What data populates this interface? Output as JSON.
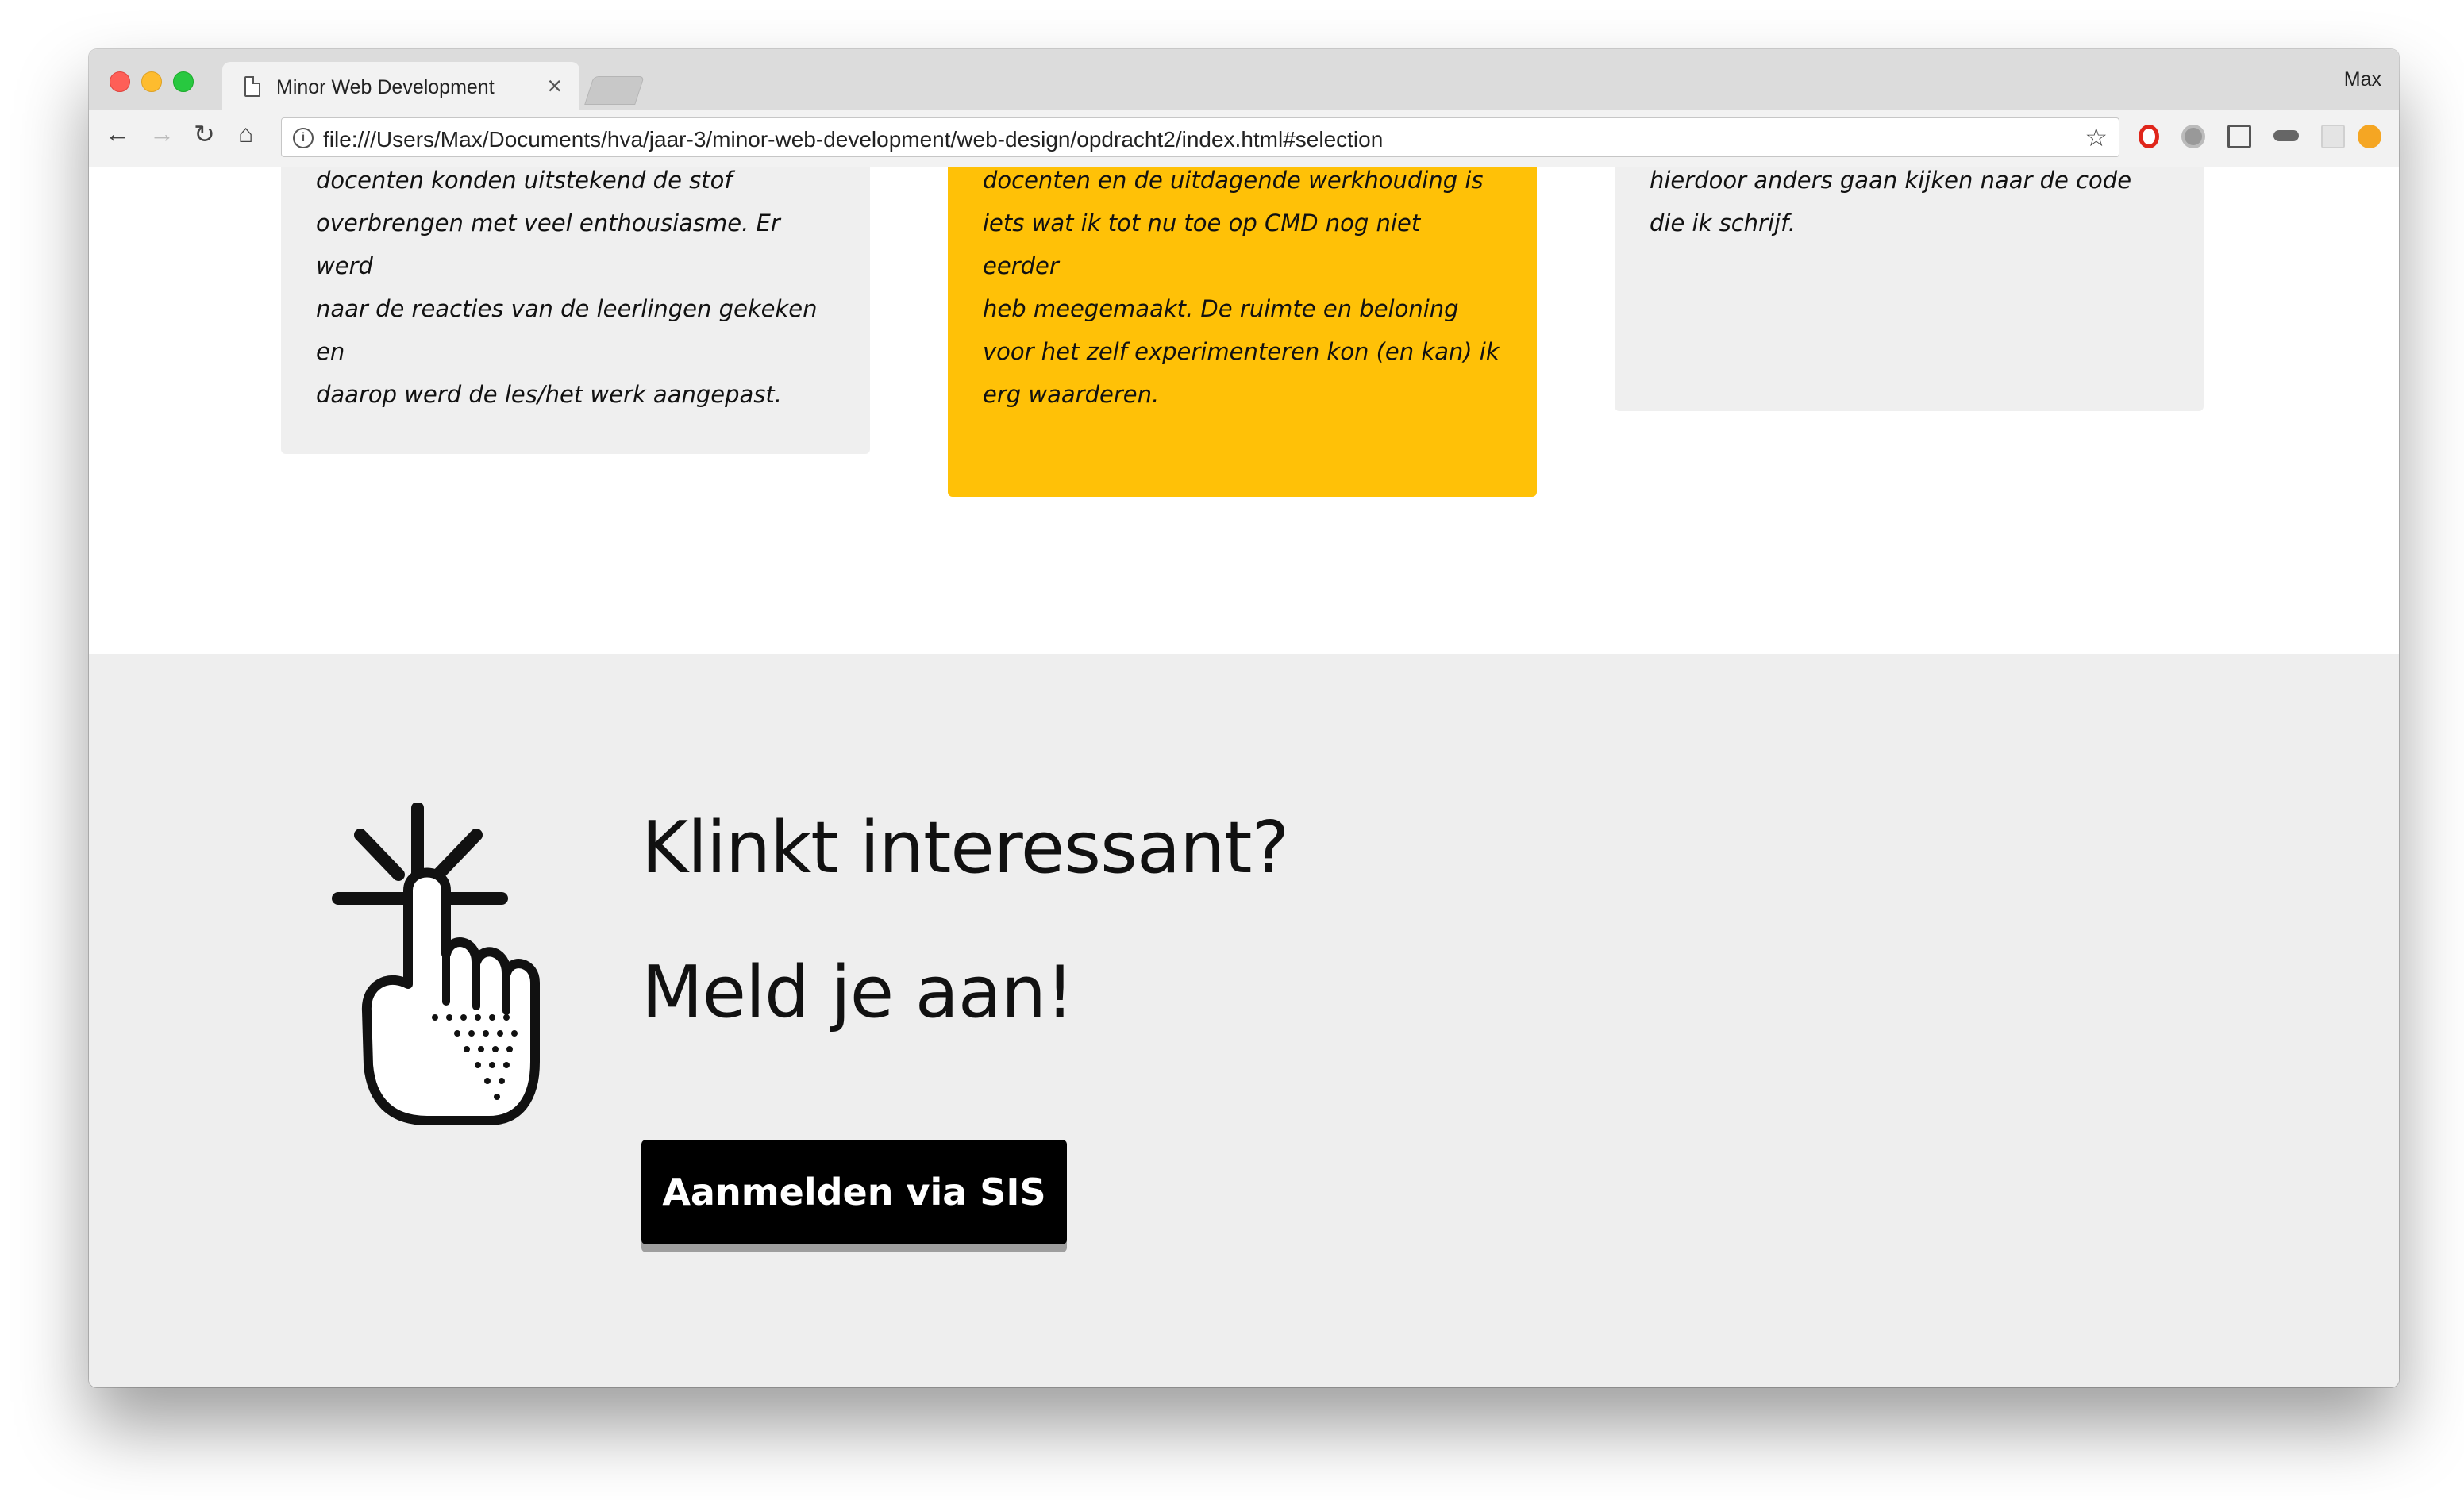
{
  "browser": {
    "tab_title": "Minor Web Development",
    "tab_close": "×",
    "profile_name": "Max",
    "url": "file:///Users/Max/Documents/hva/jaar-3/minor-web-development/web-design/opdracht2/index.html#selection",
    "nav": {
      "back": "←",
      "forward": "→",
      "reload": "↻",
      "home": "⌂",
      "bookmark": "☆"
    },
    "extensions": [
      "opera-icon",
      "settings-extension-icon",
      "cast-icon",
      "glasses-extension-icon",
      "grid-extension-icon",
      "upload-extension-icon"
    ]
  },
  "cards": [
    {
      "lines": [
        "docenten konden uitstekend de stof",
        "overbrengen met veel enthousiasme. Er werd",
        "naar de reacties van de leerlingen gekeken en",
        "daarop werd de les/het werk aangepast."
      ]
    },
    {
      "lines": [
        "docenten en de uitdagende werkhouding is",
        "iets wat ik tot nu toe op CMD nog niet eerder",
        "heb meegemaakt. De ruimte en beloning",
        "voor het zelf experimenteren kon (en kan) ik",
        "erg waarderen."
      ]
    },
    {
      "lines": [
        "hierdoor anders gaan kijken naar de code",
        "die ik schrijf."
      ]
    }
  ],
  "cta": {
    "heading_1": "Klinkt interessant?",
    "heading_2": "Meld je aan!",
    "button_label": "Aanmelden via SIS",
    "icon": "pointing-hand-icon"
  },
  "colors": {
    "highlight_card": "#ffc107",
    "card": "#efefef",
    "cta_background": "#eeeeee",
    "button": "#000000"
  }
}
